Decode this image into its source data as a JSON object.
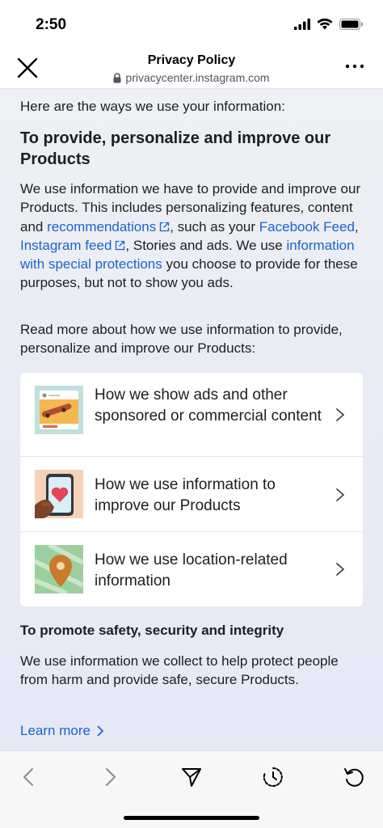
{
  "status": {
    "time": "2:50"
  },
  "header": {
    "title": "Privacy Policy",
    "url": "privacycenter.instagram.com"
  },
  "content": {
    "intro": "Here are the ways we use your information:",
    "section_title": "To provide, personalize and improve our Products",
    "para1": {
      "t1": "We use information we have to provide and improve our Products. This includes personalizing features, content and ",
      "link1": "recommendations",
      "t2": ", such as your ",
      "link2": "Facebook Feed",
      "t3": ", ",
      "link3": "Instagram feed",
      "t4": ", Stories and ads. We use ",
      "link4": "information with special protections",
      "t5": " you choose to provide for these purposes, but not to show you ads."
    },
    "para2": "Read more about how we use information to provide, personalize and improve our Products:",
    "cards": [
      {
        "label": "How we show ads and other sponsored or commercial content",
        "icon": "skateboard-ad-icon"
      },
      {
        "label": "How we use information to improve our Products",
        "icon": "phone-heart-icon"
      },
      {
        "label": "How we use location-related information",
        "icon": "map-pin-icon"
      }
    ],
    "section2_title": "To promote safety, security and integrity",
    "para3": "We use information we collect to help protect people from harm and provide safe, secure Products.",
    "learn_more": "Learn more"
  },
  "colors": {
    "link": "#1a65c9",
    "text": "#1c1e21",
    "background_gradient_top": "#eef0f3",
    "background_gradient_bottom": "#e6e8f6"
  }
}
